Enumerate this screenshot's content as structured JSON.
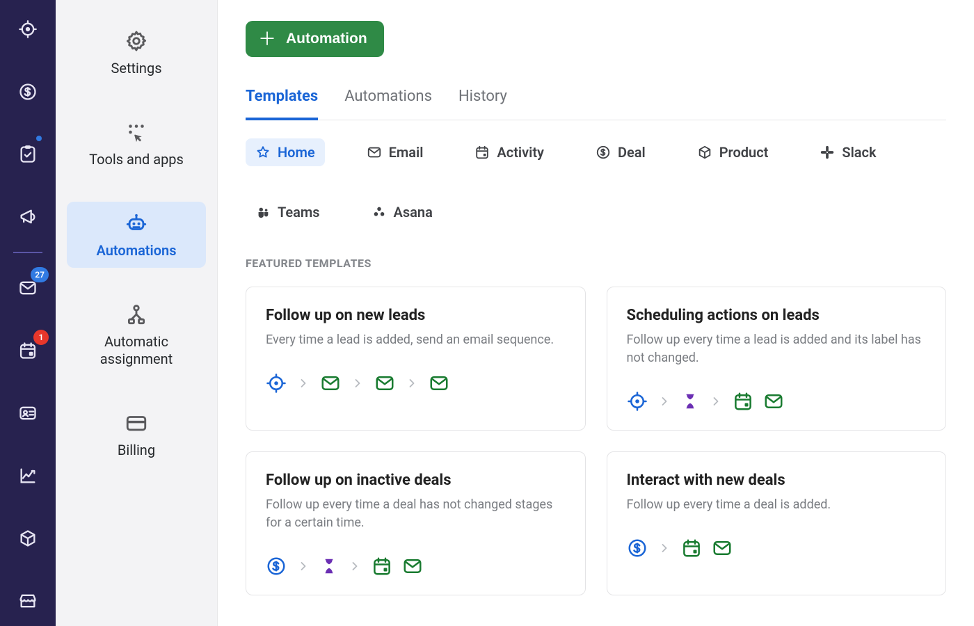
{
  "rail": {
    "badge_mail": "27",
    "badge_cal": "1"
  },
  "sidebar": {
    "items": [
      {
        "label": "Settings"
      },
      {
        "label": "Tools and apps"
      },
      {
        "label": "Automations"
      },
      {
        "label": "Automatic assignment"
      },
      {
        "label": "Billing"
      }
    ]
  },
  "header": {
    "add_button": "Automation"
  },
  "tabs": [
    {
      "label": "Templates"
    },
    {
      "label": "Automations"
    },
    {
      "label": "History"
    }
  ],
  "chips": [
    {
      "label": "Home"
    },
    {
      "label": "Email"
    },
    {
      "label": "Activity"
    },
    {
      "label": "Deal"
    },
    {
      "label": "Product"
    },
    {
      "label": "Slack"
    },
    {
      "label": "Teams"
    },
    {
      "label": "Asana"
    }
  ],
  "section_title": "Featured Templates",
  "cards": [
    {
      "title": "Follow up on new leads",
      "desc": "Every time a lead is added, send an email sequence."
    },
    {
      "title": "Scheduling actions on leads",
      "desc": "Follow up every time a lead is added and its label has not changed."
    },
    {
      "title": "Follow up on inactive deals",
      "desc": "Follow up every time a deal has not changed stages for a certain time."
    },
    {
      "title": "Interact with new deals",
      "desc": "Follow up every time a deal is added."
    }
  ]
}
